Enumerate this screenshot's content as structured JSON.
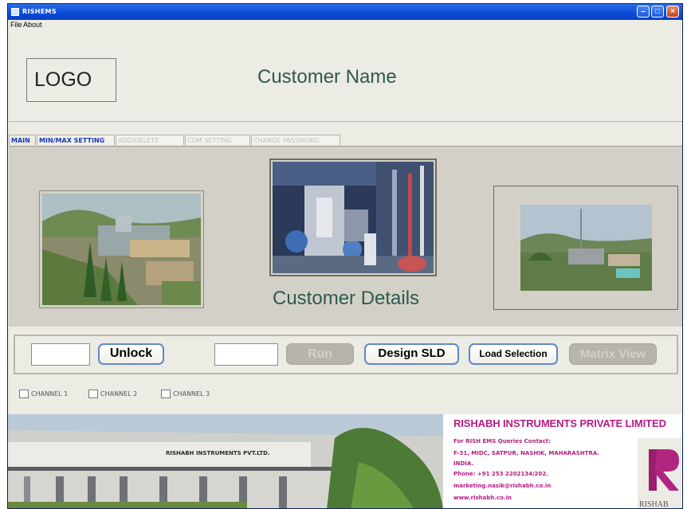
{
  "window": {
    "title": "RISHEMS"
  },
  "menu": {
    "items": [
      "File",
      "About"
    ]
  },
  "header": {
    "logo_text": "LOGO",
    "customer_name": "Customer Name"
  },
  "tabs": [
    {
      "label": "MAIN",
      "state": "active"
    },
    {
      "label": "MIN/MAX SETTING",
      "state": "enabled"
    },
    {
      "label": "ADD/DELETE",
      "state": "disabled"
    },
    {
      "label": "COM SETTING",
      "state": "disabled"
    },
    {
      "label": "CHANGE PASSWORD",
      "state": "disabled"
    }
  ],
  "main": {
    "customer_details": "Customer Details"
  },
  "controls": {
    "unlock_input_value": "",
    "unlock_label": "Unlock",
    "run_input_value": "",
    "run_label": "Run",
    "design_sld_label": "Design SLD",
    "load_selection_label": "Load Selection",
    "matrix_view_label": "Matrix View"
  },
  "channels": [
    "CHANNEL 1",
    "CHANNEL 2",
    "CHANNEL 3"
  ],
  "company": {
    "name": "RISHABH INSTRUMENTS PRIVATE LIMITED",
    "contact_heading": "For RISH EMS Queries Contact:",
    "address_line1": "F-31, MIDC, SATPUR, NASHIK, MAHARASHTRA.",
    "address_line2": "INDIA.",
    "phone": "Phone: +91 253 2202134/202.",
    "email": "marketing.nasik@rishabh.co.in",
    "website": "www.rishabh.co.in",
    "building_sign": "RISHABH INSTRUMENTS PVT.LTD.",
    "logo_text": "RISHAB"
  },
  "colors": {
    "title_bar": "#0a4bd6",
    "accent_text": "#2e5a50",
    "company_text": "#b71a85",
    "button_border": "#5e88c8"
  }
}
